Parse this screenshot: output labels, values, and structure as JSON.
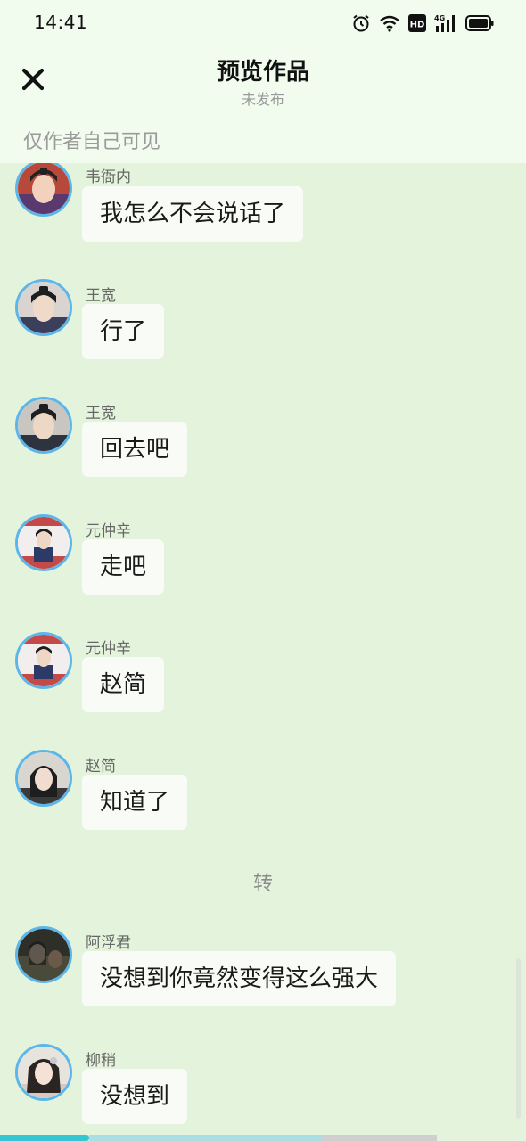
{
  "status_bar": {
    "time": "14:41",
    "network_label": "4G",
    "hd_label": "HD"
  },
  "header": {
    "title": "预览作品",
    "subtitle": "未发布",
    "visibility_note": "仅作者自己可见"
  },
  "messages": [
    {
      "name": "韦衙内",
      "text": "我怎么不会说话了"
    },
    {
      "name": "王宽",
      "text": "行了"
    },
    {
      "name": "王宽",
      "text": "回去吧"
    },
    {
      "name": "元仲辛",
      "text": "走吧"
    },
    {
      "name": "元仲辛",
      "text": "赵简"
    },
    {
      "name": "赵简",
      "text": "知道了"
    },
    {
      "name": "阿浮君",
      "text": "没想到你竟然变得这么强大"
    },
    {
      "name": "柳稍",
      "text": "没想到"
    }
  ],
  "divider_text": "转",
  "colors": {
    "accent": "#36c6d3",
    "avatar_ring": "#5cb6ea",
    "background": "#e4f4dc",
    "bubble": "#f9fcf6"
  },
  "progress": {
    "fraction": 0.17
  }
}
